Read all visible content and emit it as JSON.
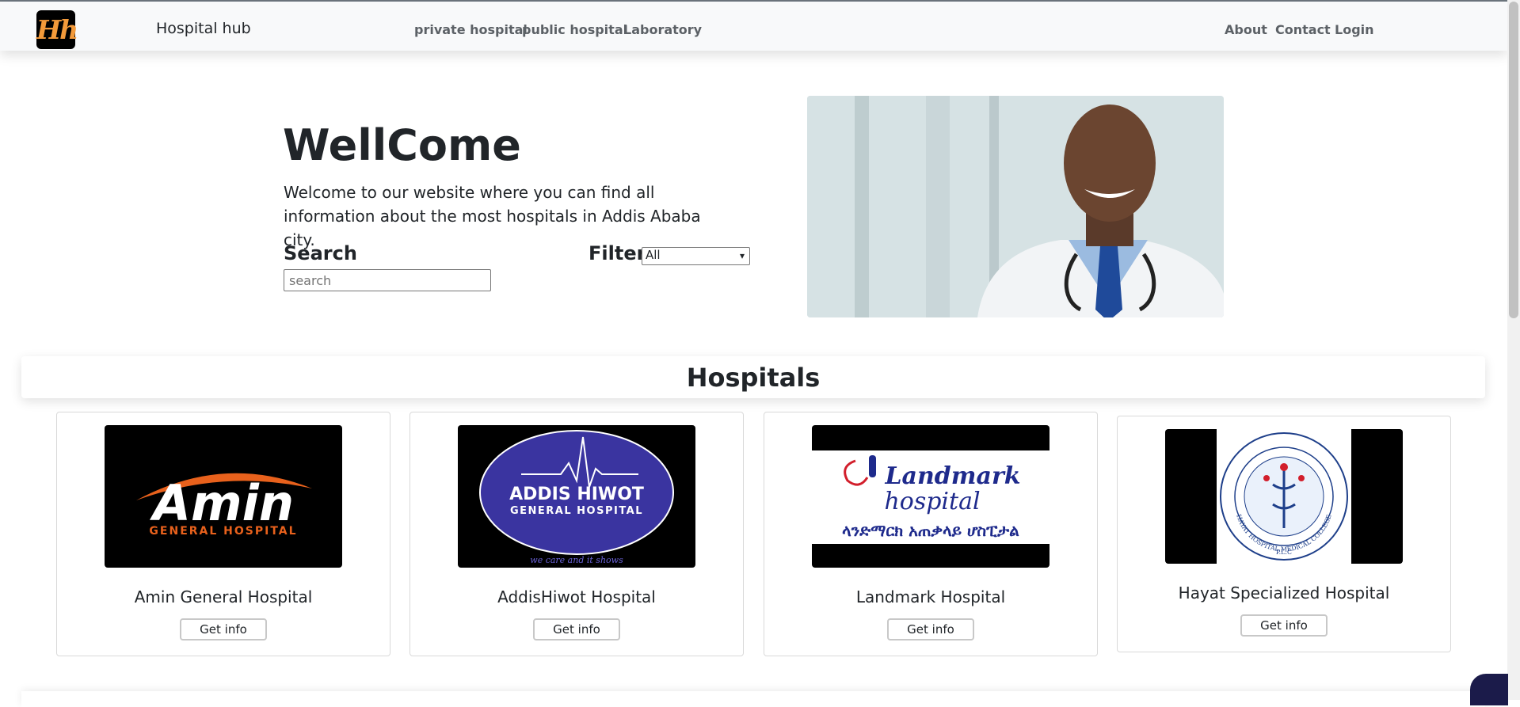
{
  "nav": {
    "logo_text": "Hh",
    "brand": "Hospital hub",
    "links": [
      "private hospital",
      "public hospital",
      "Laboratory"
    ],
    "right_links": [
      "About",
      "Contact",
      "Login"
    ]
  },
  "hero": {
    "title": "WellCome",
    "text": "Welcome to our website where you can find all information about the most hospitals in Addis Ababa city.",
    "search_label": "Search",
    "search_placeholder": "search",
    "filter_label": "Filter",
    "filter_value": "All"
  },
  "section": {
    "title": "Hospitals"
  },
  "cards": [
    {
      "name": "Amin General Hospital",
      "logo_main": "Amin",
      "logo_sub": "GENERAL HOSPITAL",
      "button": "Get info"
    },
    {
      "name": "AddisHiwot Hospital",
      "logo_main": "ADDIS HIWOT",
      "logo_sub": "GENERAL HOSPITAL",
      "logo_tag": "we care and it shows",
      "button": "Get info"
    },
    {
      "name": "Landmark Hospital",
      "logo_main": "Landmark",
      "logo_sub": "hospital",
      "logo_amharic": "ላንድማርክ አጠቃላይ ሆስፒታል",
      "button": "Get info"
    },
    {
      "name": "Hayat Specialized Hospital",
      "logo_ring": "HAYAT HOSPITAL MEDICAL COLLEGE",
      "logo_plc": "P.L.C",
      "button": "Get info"
    }
  ],
  "colors": {
    "logo_orange": "#f39a3a",
    "amin_orange": "#e8611c",
    "addis_blue": "#3a34a0",
    "landmark_blue": "#1e2a8c"
  }
}
